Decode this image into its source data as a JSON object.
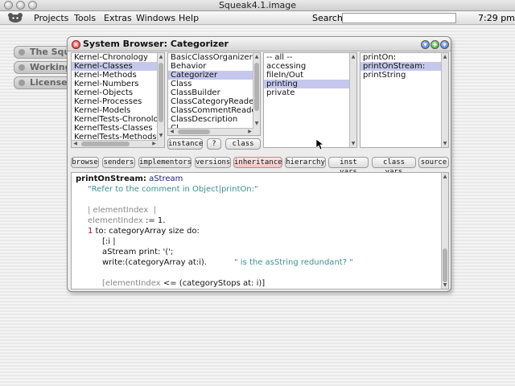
{
  "mac": {
    "title": "Squeak4.1.image"
  },
  "menubar": {
    "items": [
      "Projects",
      "Tools",
      "Extras",
      "Windows",
      "Help"
    ],
    "search_label": "Search:",
    "search_value": "",
    "clock": "7:29 pm"
  },
  "flaps": [
    "The Squ",
    "Working",
    "License"
  ],
  "browser": {
    "title": "System Browser: Categorizer",
    "categories": [
      "Kernel-Chronology",
      "Kernel-Classes",
      "Kernel-Methods",
      "Kernel-Numbers",
      "Kernel-Objects",
      "Kernel-Processes",
      "Kernel-Models",
      "KernelTests-Chronolo",
      "KernelTests-Classes",
      "KernelTests-Methods"
    ],
    "classes": [
      "BasicClassOrganizer",
      "Behavior",
      "Categorizer",
      "Class",
      "ClassBuilder",
      "ClassCategoryReade",
      "ClassCommentReade",
      "ClassDescription",
      "Cl..."
    ],
    "protocols": [
      "-- all --",
      "accessing",
      "fileIn/Out",
      "printing",
      "private"
    ],
    "methods": [
      "printOn:",
      "printOnStream:",
      "printString"
    ],
    "class_buttons": {
      "instance": "instance",
      "help": "?",
      "class": "class"
    },
    "toolbar": [
      "browse",
      "senders",
      "implementors",
      "versions",
      "inheritance",
      "hierarchy",
      "inst vars",
      "class vars",
      "source"
    ],
    "code": {
      "selector": "printOnStream:",
      "arg": " aStream",
      "comment": "\"Refer to the comment in Object|printOn:\"",
      "line_temps": "| elementIndex  |",
      "line_assign_a": "elementIndex",
      "line_assign_b": " := ",
      "line_assign_c": "1",
      "line_assign_d": ".",
      "line_loop_a": "1",
      "line_loop_b": " to: categoryArray size do:",
      "line_block": "[:i |",
      "line_print": "aStream print: '(';",
      "line_write": "write:(categoryArray at:i).",
      "line_write_comment": "\" is the asString redundant? \"",
      "line_last_a": "[elementIndex",
      "line_last_b": " <= (categoryStops at: i)]"
    }
  }
}
